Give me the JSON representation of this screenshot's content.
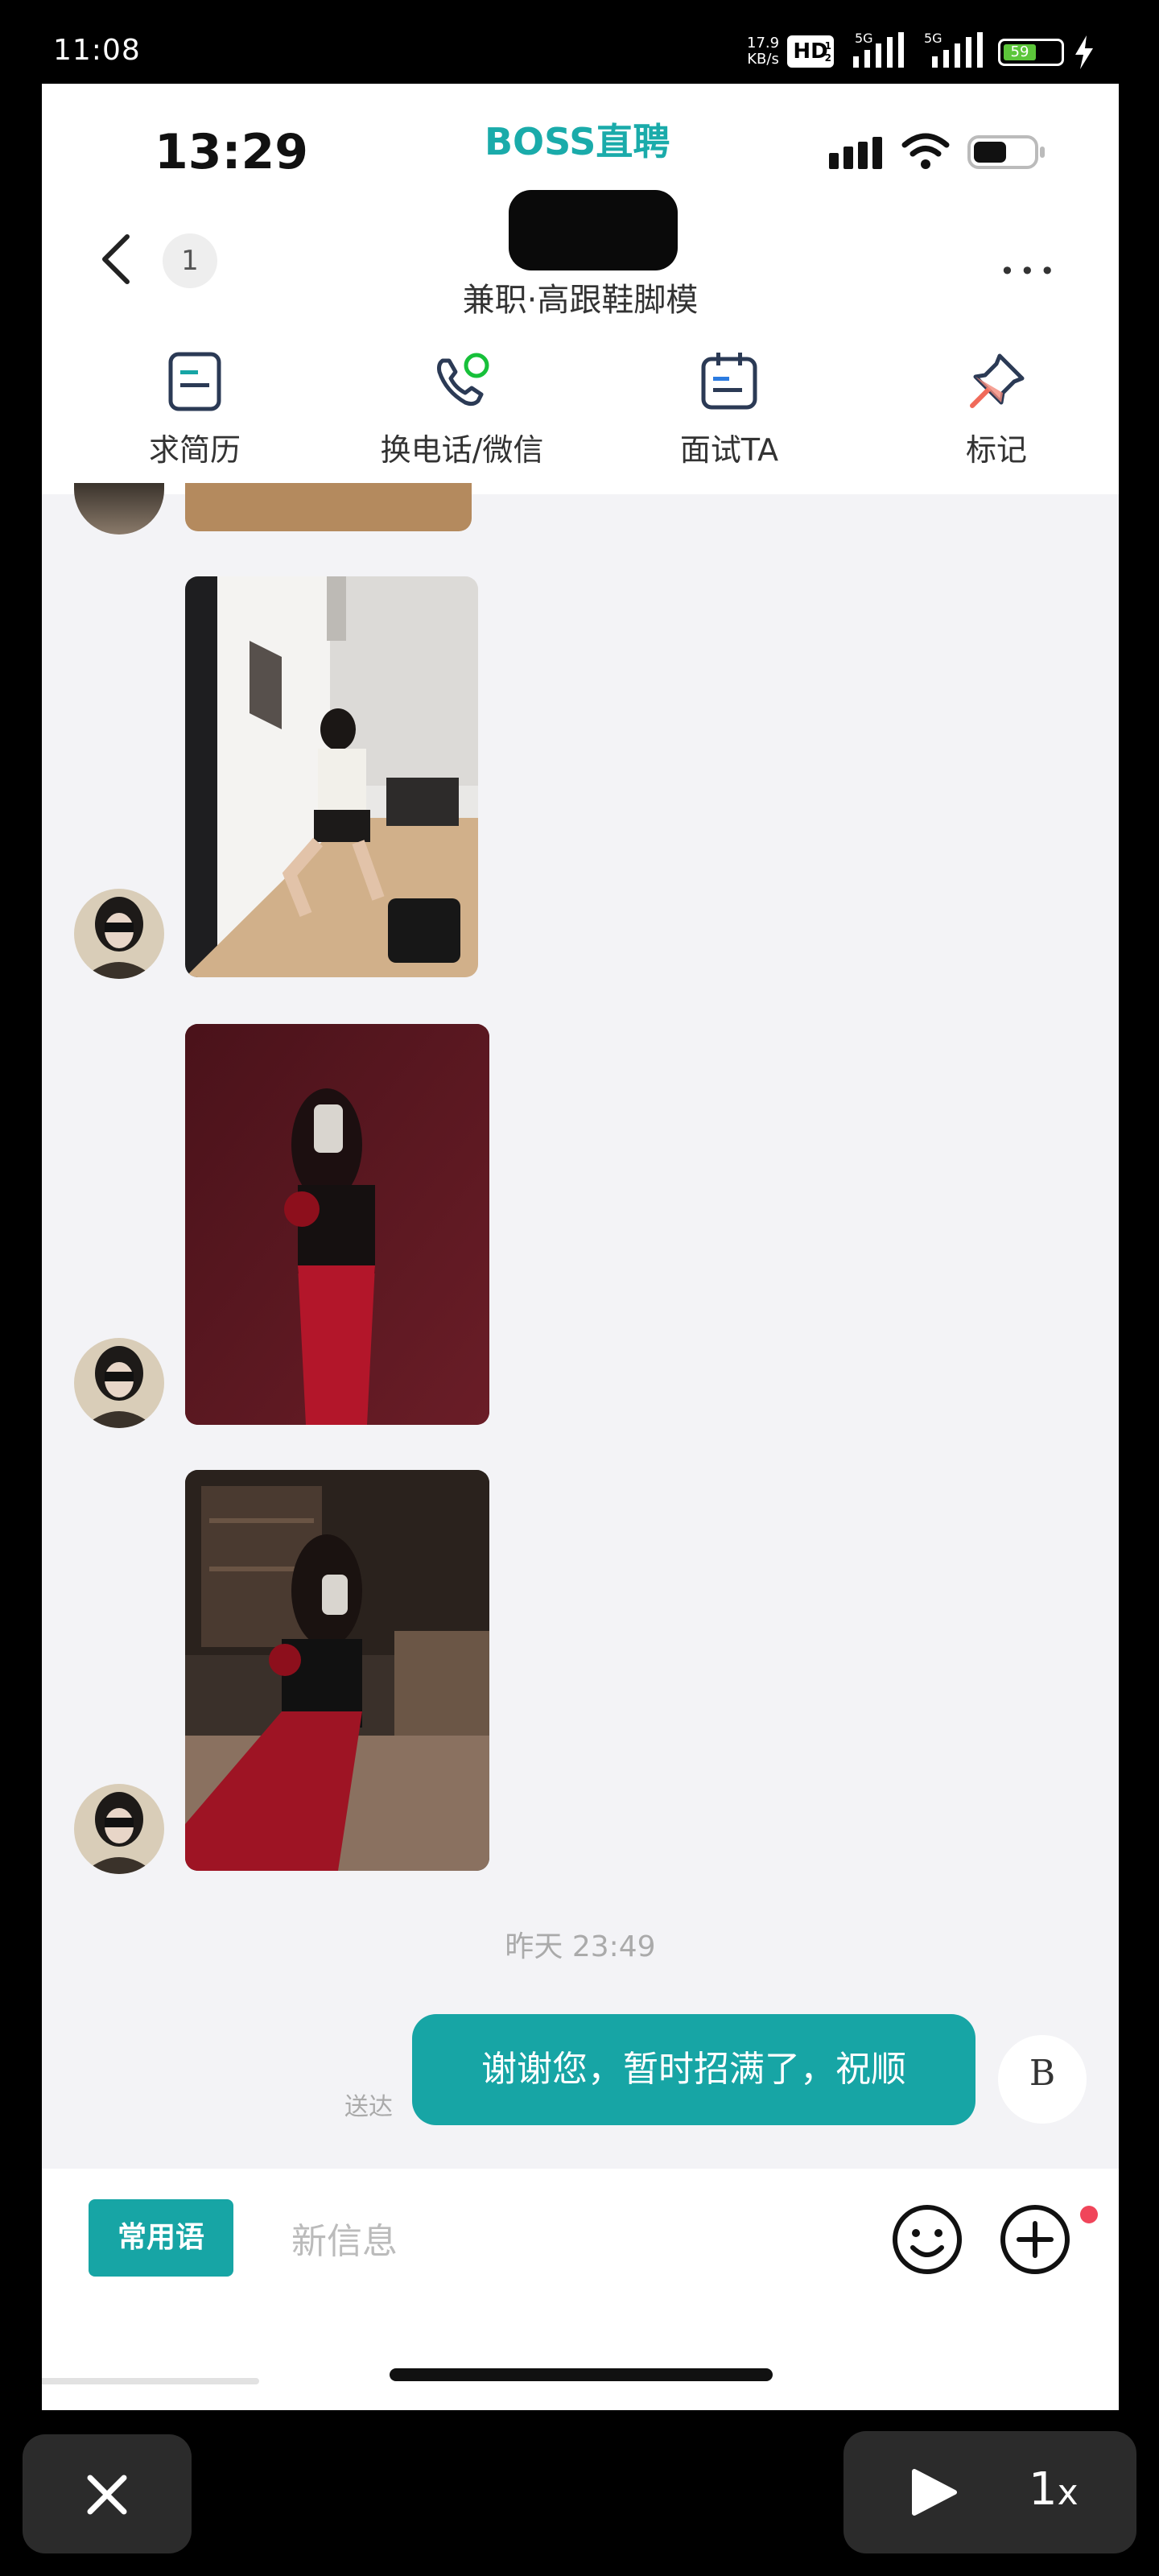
{
  "outer_status": {
    "time": "11:08",
    "net_speed_value": "17.9",
    "net_speed_unit": "KB/s",
    "hd_label": "HD",
    "hd_index": "1",
    "hd_sub": "2",
    "sig1_label": "5G",
    "sig2_label": "5G",
    "battery": "59"
  },
  "app": {
    "time": "13:29",
    "brand": "BOSS直聘",
    "unread_badge": "1",
    "job_subtitle": "兼职·高跟鞋脚模",
    "more_label": "•••"
  },
  "actions": [
    {
      "label": "求简历",
      "icon": "resume-icon"
    },
    {
      "label": "换电话/微信",
      "icon": "phone-wechat-icon"
    },
    {
      "label": "面试TA",
      "icon": "calendar-icon"
    },
    {
      "label": "标记",
      "icon": "pin-icon"
    }
  ],
  "chat": {
    "timestamp": "昨天 23:49",
    "my_message": "谢谢您，暂时招满了，祝顺",
    "delivered": "送达",
    "my_avatar_text": "B"
  },
  "input": {
    "phrase_button": "常用语",
    "placeholder": "新信息"
  },
  "player": {
    "speed": "1",
    "speed_suffix": "x"
  },
  "colors": {
    "accent": "#17a5a5",
    "brand": "#1aabaa",
    "chat_bg": "#f3f3f6"
  }
}
